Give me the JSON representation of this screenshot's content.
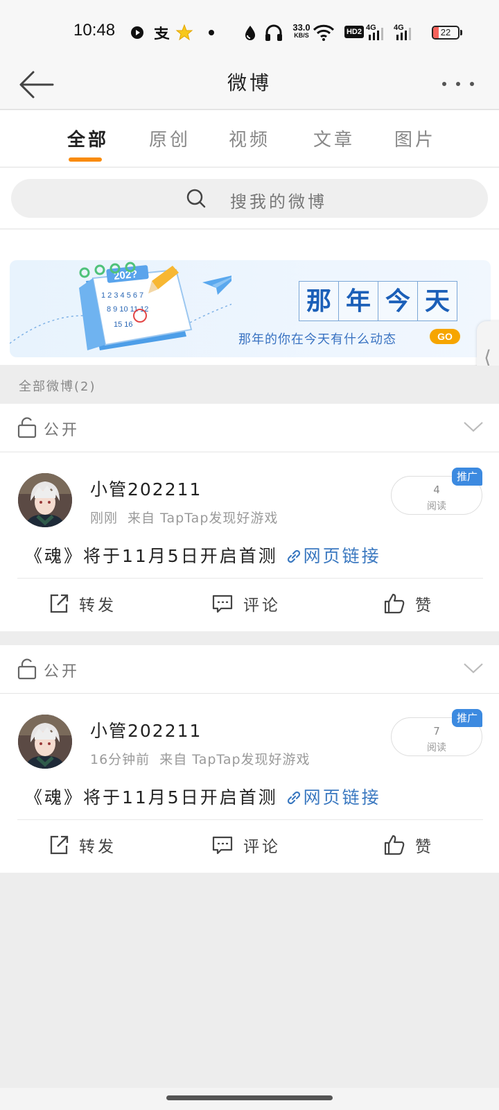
{
  "status_bar": {
    "time": "10:48",
    "net_speed": "33.0",
    "net_speed_unit": "KB/S",
    "hd_badge": "HD2",
    "network_1": "4G",
    "network_2": "4G",
    "battery": "22",
    "battery_level": 0.22,
    "battery_color": "#f5625b"
  },
  "nav": {
    "title": "微博"
  },
  "tabs": [
    {
      "label": "全部",
      "active": true
    },
    {
      "label": "原创",
      "active": false
    },
    {
      "label": "视频",
      "active": false
    },
    {
      "label": "文章",
      "active": false
    },
    {
      "label": "图片",
      "active": false
    }
  ],
  "tab_accent": "#f98b0b",
  "search": {
    "placeholder": "搜我的微博"
  },
  "banner": {
    "calendar_year": "202?",
    "title_chars": [
      "那",
      "年",
      "今",
      "天"
    ],
    "subtitle": "那年的你在今天有什么动态",
    "go_label": "GO"
  },
  "section_header": "全部微博(2)",
  "posts": [
    {
      "visibility": "公开",
      "username": "小管202211",
      "time": "刚刚",
      "source": "来自 TapTap发现好游戏",
      "read_count": "4",
      "read_label": "阅读",
      "badge": "推广",
      "text": "《魂》将于11月5日开启首测",
      "link_text": "网页链接",
      "actions": {
        "repost": "转发",
        "comment": "评论",
        "like": "赞"
      }
    },
    {
      "visibility": "公开",
      "username": "小管202211",
      "time": "16分钟前",
      "source": "来自 TapTap发现好游戏",
      "read_count": "7",
      "read_label": "阅读",
      "badge": "推广",
      "text": "《魂》将于11月5日开启首测",
      "link_text": "网页链接",
      "actions": {
        "repost": "转发",
        "comment": "评论",
        "like": "赞"
      }
    }
  ],
  "icons": [
    "back-arrow-icon",
    "more-icon",
    "search-icon",
    "lock-icon",
    "chevron-down-icon",
    "link-icon",
    "repost-icon",
    "comment-icon",
    "like-icon"
  ]
}
